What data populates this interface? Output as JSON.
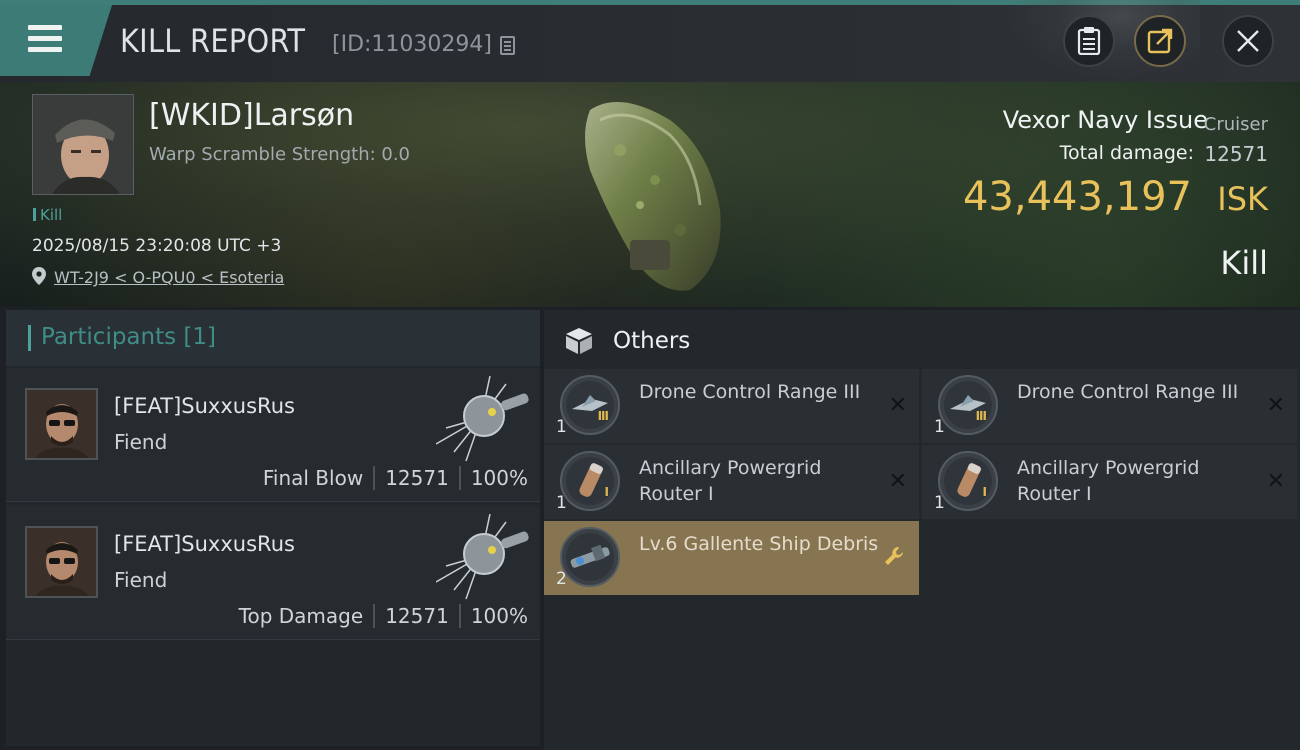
{
  "header": {
    "title": "KILL REPORT",
    "report_id": "[ID:11030294]"
  },
  "victim": {
    "pilot_name": "[WKID]Larsøn",
    "warp_scramble": "Warp Scramble Strength: 0.0",
    "tag": "Kill",
    "timestamp": "2025/08/15 23:20:08 UTC +3",
    "location": "WT-2J9 < O-PQU0 < Esoteria",
    "ship_name": "Vexor Navy Issue",
    "ship_class": "Cruiser",
    "total_damage_label": "Total damage:",
    "total_damage_value": "12571",
    "isk_value": "43,443,197",
    "isk_unit": "ISK",
    "outcome": "Kill"
  },
  "participants": {
    "title": "Participants",
    "count": "[1]",
    "cards": [
      {
        "name": "[FEAT]SuxxusRus",
        "ship": "Fiend",
        "role": "Final Blow",
        "damage": "12571",
        "percent": "100%"
      },
      {
        "name": "[FEAT]SuxxusRus",
        "ship": "Fiend",
        "role": "Top Damage",
        "damage": "12571",
        "percent": "100%"
      }
    ]
  },
  "others": {
    "title": "Others",
    "items": [
      {
        "name": "Drone Control Range III",
        "qty": "1",
        "tier": "III",
        "action": "×"
      },
      {
        "name": "Drone Control Range III",
        "qty": "1",
        "tier": "III",
        "action": "×"
      },
      {
        "name": "Ancillary Powergrid Router I",
        "qty": "1",
        "tier": "I",
        "action": "×"
      },
      {
        "name": "Ancillary Powergrid Router I",
        "qty": "1",
        "tier": "I",
        "action": "×"
      },
      {
        "name": "Lv.6 Gallente Ship Debris",
        "qty": "2",
        "tier": "",
        "action": "wrench"
      }
    ]
  },
  "colors": {
    "accent_teal": "#3d7c76",
    "isk_gold": "#e8c15b",
    "highlight_item": "#877552"
  }
}
